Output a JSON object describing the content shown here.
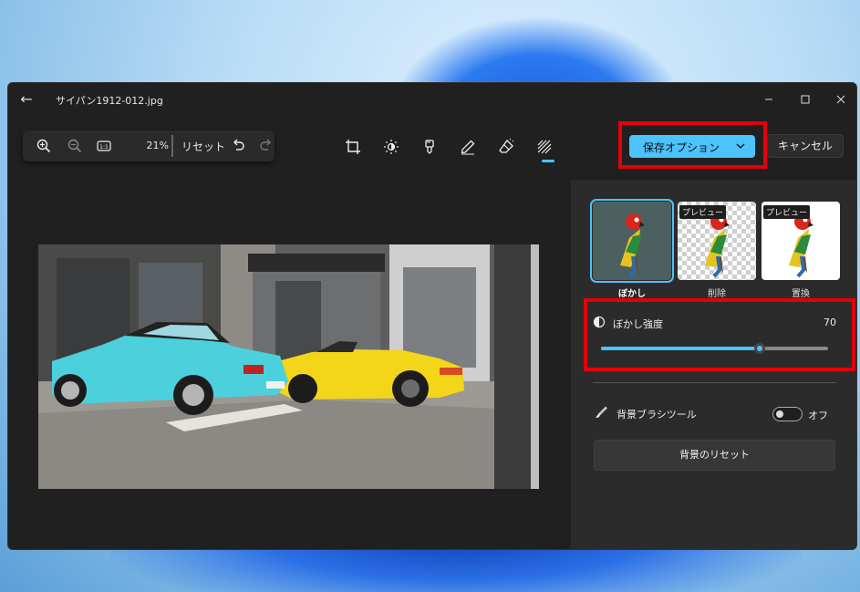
{
  "window": {
    "file_name": "サイパン1912-012.jpg"
  },
  "zoom_toolbar": {
    "zoom_percent": "21%",
    "reset_label": "リセット"
  },
  "actions": {
    "save_label": "保存オプション",
    "cancel_label": "キャンセル"
  },
  "background_panel": {
    "modes": [
      {
        "label": "ぼかし",
        "selected": true
      },
      {
        "label": "削除",
        "badge": "プレビュー"
      },
      {
        "label": "置換",
        "badge": "プレビュー"
      }
    ],
    "blur": {
      "label": "ぼかし強度",
      "value": "70",
      "level_fraction": 0.7
    },
    "brush": {
      "label": "背景ブラシツール",
      "toggle_state": "オフ"
    },
    "reset_button_label": "背景のリセット"
  },
  "colors": {
    "accent": "#4cc2ff",
    "highlight_box": "#e3000b"
  }
}
